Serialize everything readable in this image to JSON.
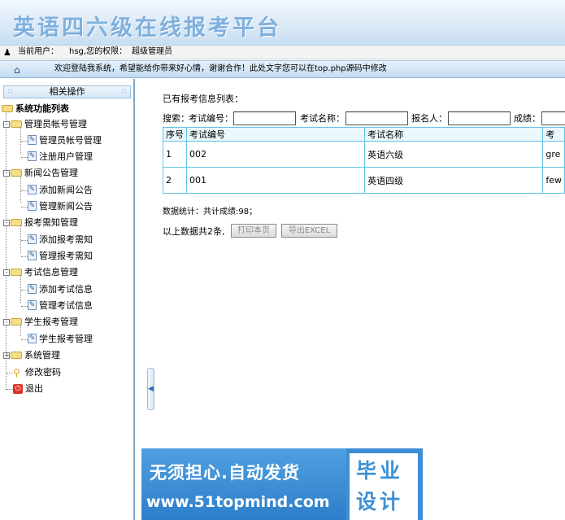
{
  "header": {
    "title": "英语四六级在线报考平台"
  },
  "userbar": {
    "label": "当前用户：",
    "username": "hsg,您的权限：",
    "role": "超级管理员"
  },
  "welcome": {
    "text": "欢迎登陆我系统，希望能给你带来好心情，谢谢合作！此处文字您可以在top.php源码中修改"
  },
  "sidebar": {
    "header": "相关操作",
    "root": "系统功能列表",
    "groups": [
      {
        "label": "管理员帐号管理",
        "expanded": true,
        "items": [
          {
            "label": "管理员帐号管理"
          },
          {
            "label": "注册用户管理"
          }
        ]
      },
      {
        "label": "新闻公告管理",
        "expanded": true,
        "items": [
          {
            "label": "添加新闻公告"
          },
          {
            "label": "管理新闻公告"
          }
        ]
      },
      {
        "label": "报考需知管理",
        "expanded": true,
        "items": [
          {
            "label": "添加报考需知"
          },
          {
            "label": "管理报考需知"
          }
        ]
      },
      {
        "label": "考试信息管理",
        "expanded": true,
        "items": [
          {
            "label": "添加考试信息"
          },
          {
            "label": "管理考试信息"
          }
        ]
      },
      {
        "label": "学生报考管理",
        "expanded": true,
        "items": [
          {
            "label": "学生报考管理"
          }
        ]
      },
      {
        "label": "系统管理",
        "expanded": false,
        "items": []
      }
    ],
    "extra": [
      {
        "label": "修改密码",
        "icon": "key-icon"
      },
      {
        "label": "退出",
        "icon": "exit-icon"
      }
    ]
  },
  "main": {
    "list_title": "已有报考信息列表：",
    "search": {
      "prefix": "搜索：",
      "exam_no_label": "考试编号：",
      "exam_name_label": "考试名称：",
      "applicant_label": "报名人：",
      "score_label": "成绩："
    },
    "table": {
      "headers": [
        "序号",
        "考试编号",
        "考试名称",
        "考"
      ],
      "rows": [
        [
          "1",
          "002",
          "英语六级",
          "gre"
        ],
        [
          "2",
          "001",
          "英语四级",
          "few"
        ]
      ]
    },
    "stats": "数据统计：共计成绩:98；",
    "total": "以上数据共2条,",
    "print_button": "打印本页",
    "export_button": "导出EXCEL"
  },
  "ad": {
    "line1": "无须担心.自动发货",
    "line2": "www.51topmind.com",
    "right1": "毕业",
    "right2": "设计"
  }
}
